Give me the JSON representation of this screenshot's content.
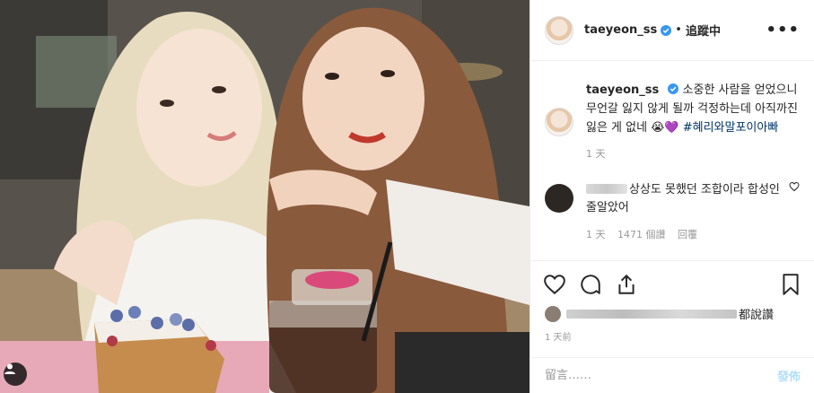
{
  "header": {
    "username": "taeyeon_ss",
    "separator": "•",
    "follow_label": "追蹤中",
    "more_label": "•••"
  },
  "caption": {
    "username": "taeyeon_ss",
    "text": "소중한 사람을 얻었으니 무언갈 잃지 않게 될까 걱정하는데 아직까진 잃은 게 없네 😭💜 ",
    "hashtag": "#혜리와말포이아빠",
    "time": "1 天"
  },
  "comment": {
    "text": "상상도 못했던 조합이라 합성인줄알았어",
    "time": "1 天",
    "likes": "1471 個讚",
    "reply": "回覆"
  },
  "likes": {
    "suffix": "都說讚"
  },
  "post_time": "1 天前",
  "add_comment": {
    "placeholder": "留言……",
    "post_label": "發佈"
  },
  "colors": {
    "verified": "#3897f0",
    "hashtag": "#003569",
    "post_disabled": "#b2dffc",
    "meta": "#999999"
  },
  "icons": [
    "verified-icon",
    "heart-icon",
    "comment-icon",
    "share-icon",
    "bookmark-icon",
    "small-heart-icon",
    "user-icon"
  ]
}
